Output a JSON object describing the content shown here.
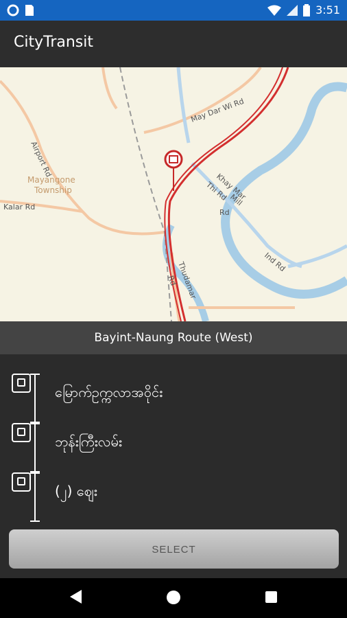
{
  "status_bar": {
    "time": "3:51",
    "battery_icon": "battery-icon",
    "wifi_icon": "wifi-icon",
    "signal_icon": "signal-icon"
  },
  "app_bar": {
    "title": "CityTransit"
  },
  "map": {
    "labels": [
      "Mayangone",
      "Township",
      "Airport Rd",
      "Kalar Rd",
      "May Dar Wi Rd",
      "Khay Mar",
      "Thi Rd",
      "Mill",
      "Rd",
      "Ind Rd",
      "Thudamar",
      "Rd"
    ],
    "marker_icon": "bus-stop-marker-icon"
  },
  "route": {
    "title": "Bayint-Naung Route (West)"
  },
  "stops": [
    {
      "name": "မြောက်ဥက္ကလာအဝိုင်း",
      "icon": "bus-icon"
    },
    {
      "name": "ဘုန်းကြီးလမ်း",
      "icon": "bus-icon"
    },
    {
      "name": "(၂) ဈေး",
      "icon": "bus-icon"
    }
  ],
  "actions": {
    "select_label": "SELECT"
  },
  "colors": {
    "status_bar": "#1565c0",
    "app_bar": "#2d2d2d",
    "route_header": "#444444",
    "route_line": "#d32f2f",
    "river": "#a7cde6"
  }
}
